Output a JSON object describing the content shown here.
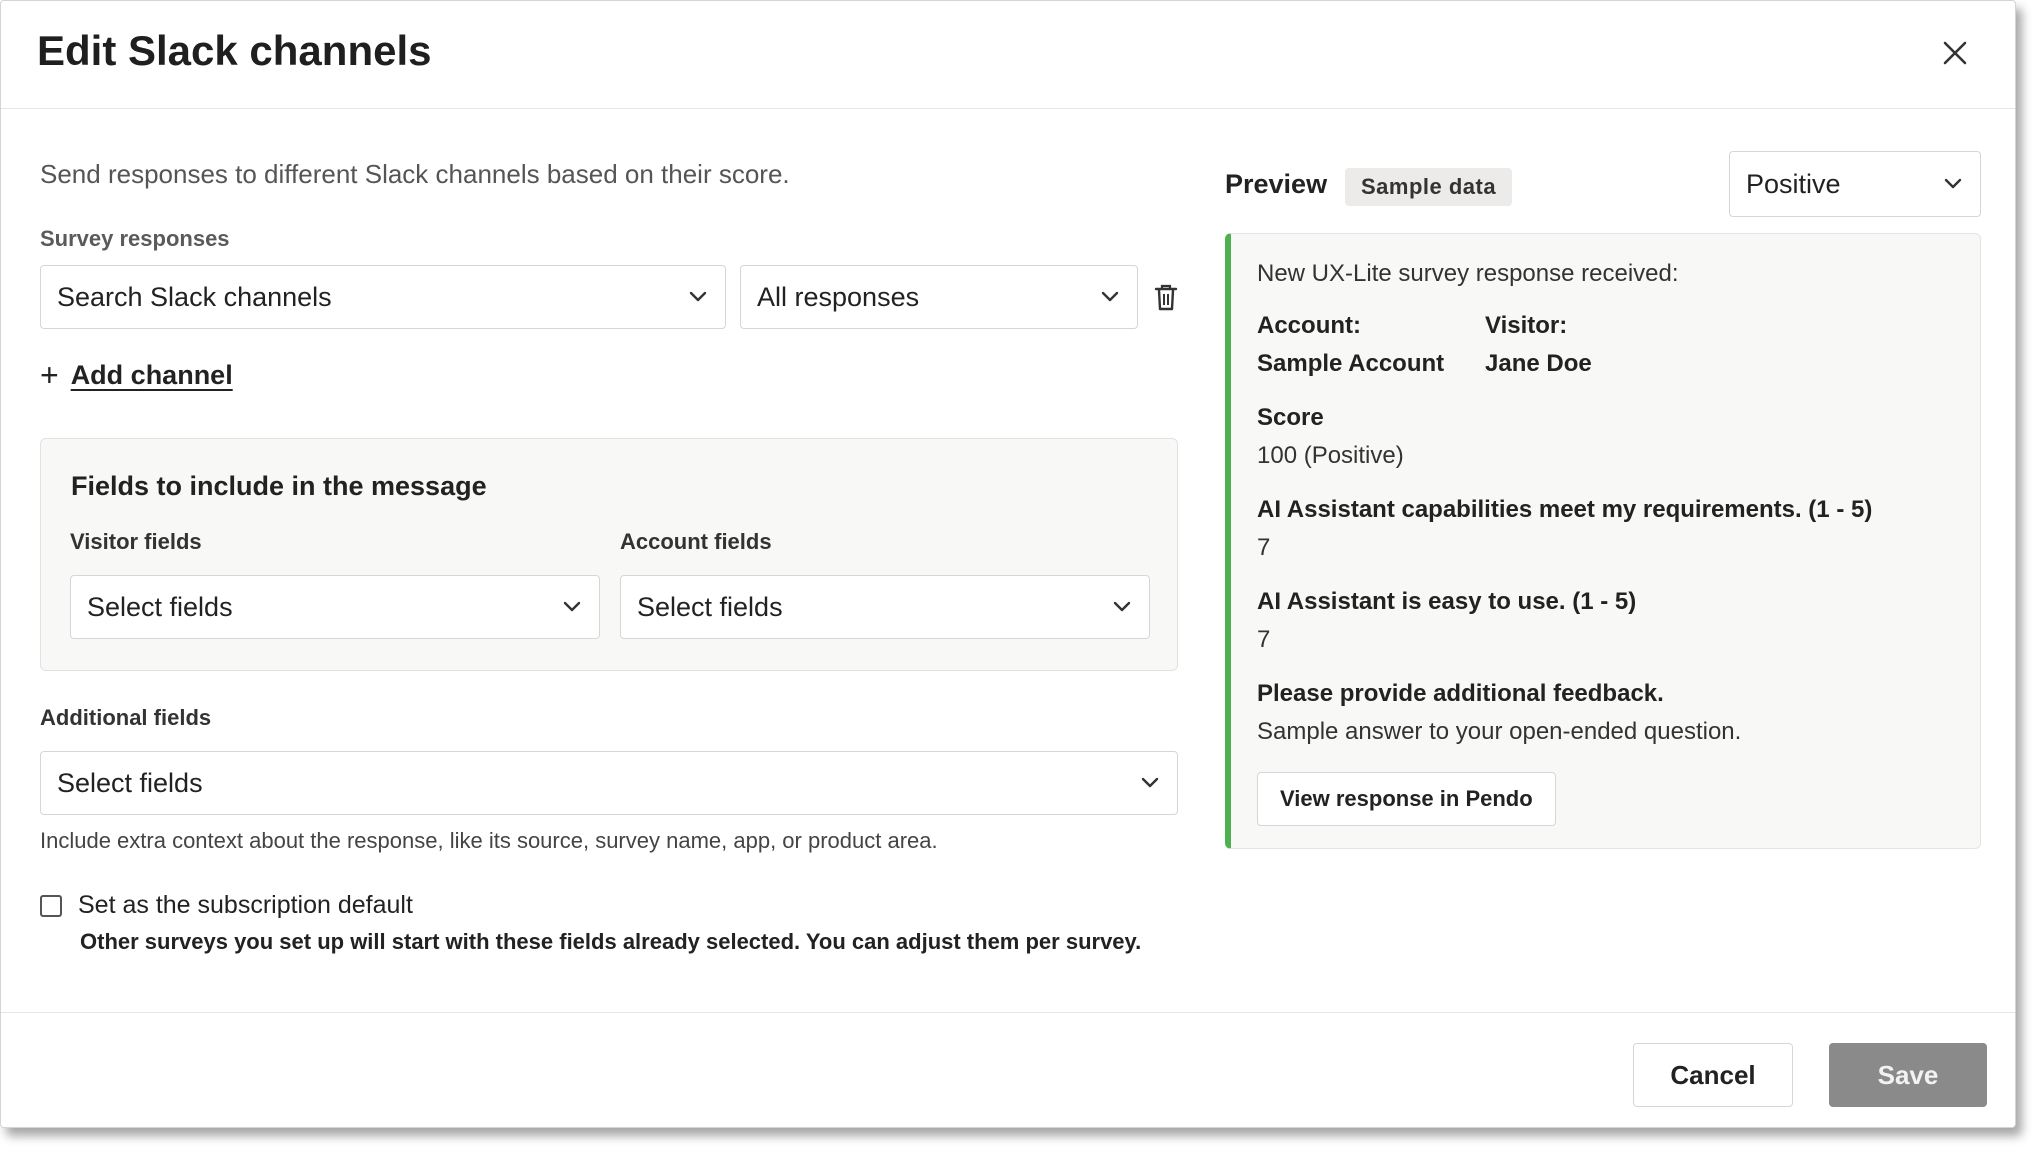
{
  "dialog": {
    "title": "Edit Slack channels",
    "intro": "Send responses to different Slack channels based on their score."
  },
  "survey_responses": {
    "label": "Survey responses",
    "channel_select": "Search Slack channels",
    "response_filter": "All responses",
    "add_channel": "Add channel"
  },
  "fields": {
    "title": "Fields to include in the message",
    "visitor_label": "Visitor fields",
    "visitor_select": "Select fields",
    "account_label": "Account fields",
    "account_select": "Select fields"
  },
  "additional": {
    "label": "Additional fields",
    "select": "Select fields",
    "hint": "Include extra context about the response, like its source, survey name, app, or product area."
  },
  "default_option": {
    "checked": false,
    "label": "Set as the subscription default",
    "description": "Other surveys you set up will start with these fields already selected. You can adjust them per survey."
  },
  "preview": {
    "label": "Preview",
    "badge": "Sample data",
    "sentiment_select": "Positive",
    "accent_color": "#4fb04f",
    "message_heading": "New UX-Lite survey response received:",
    "account_label": "Account:",
    "account_value": "Sample Account",
    "visitor_label": "Visitor:",
    "visitor_value": "Jane Doe",
    "score_label": "Score",
    "score_value": "100 (Positive)",
    "q1_label": "AI Assistant capabilities meet my requirements. (1 - 5)",
    "q1_value": "7",
    "q2_label": "AI Assistant is easy to use. (1 - 5)",
    "q2_value": "7",
    "q3_label": "Please provide additional feedback.",
    "q3_value": "Sample answer to your open-ended question.",
    "view_button": "View response in Pendo"
  },
  "footer": {
    "cancel": "Cancel",
    "save": "Save"
  },
  "icons": {
    "close": "close-icon",
    "chevron": "chevron-down-icon",
    "delete": "trash-icon",
    "add": "plus-icon"
  }
}
